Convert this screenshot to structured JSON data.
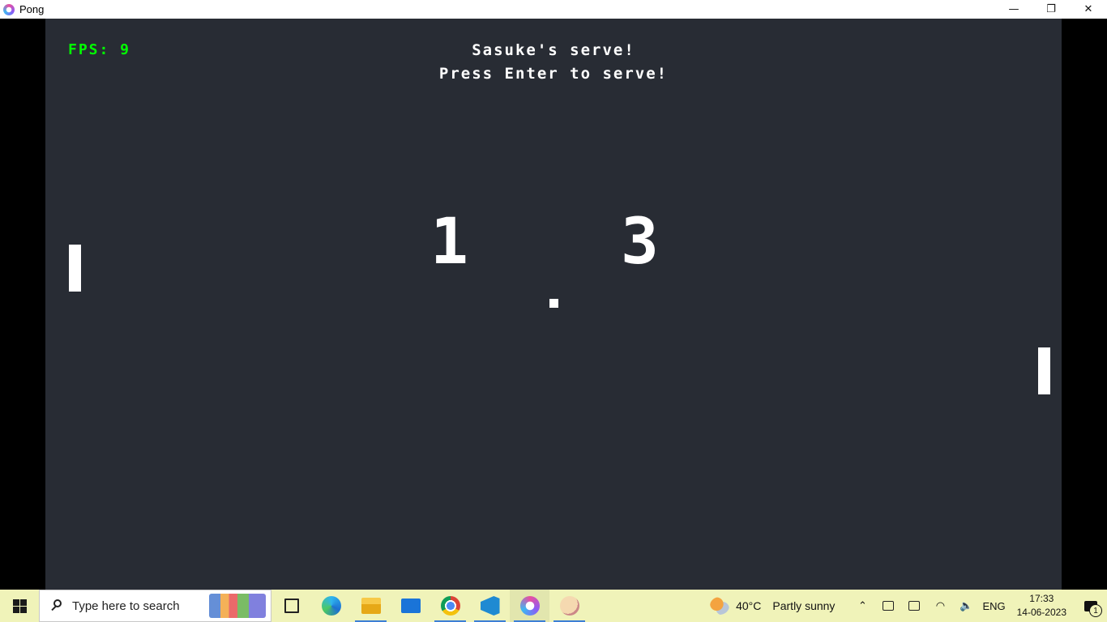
{
  "window": {
    "title": "Pong",
    "icon": "pong-app-icon",
    "controls": [
      "minimize-icon",
      "restore-icon",
      "close-icon"
    ]
  },
  "game": {
    "fps_text": "FPS: 9",
    "message_line1": "Sasuke's serve!",
    "message_line2": "Press Enter to serve!",
    "score_player1": "1",
    "score_player2": "3",
    "colors": {
      "background": "#282c34",
      "fps": "#00ff00",
      "text": "#ffffff"
    }
  },
  "taskbar": {
    "search_placeholder": "Type here to search",
    "pinned": [
      "task-view-icon",
      "edge-icon",
      "file-explorer-icon",
      "mail-icon",
      "chrome-icon",
      "vscode-icon",
      "pong-icon",
      "paint-icon"
    ],
    "weather": {
      "temperature": "40°C",
      "condition": "Partly sunny"
    },
    "language": "ENG",
    "time": "17:33",
    "date": "14-06-2023",
    "notification_count": "1"
  }
}
